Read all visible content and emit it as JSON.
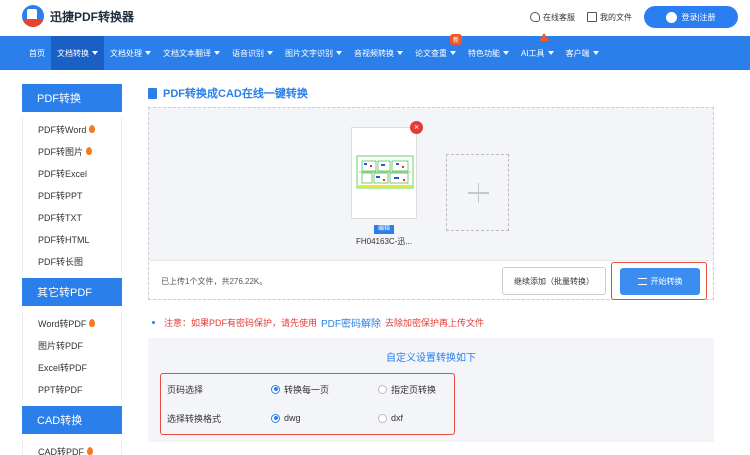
{
  "header": {
    "logo_text": "迅捷PDF转换器",
    "service_label": "在线客服",
    "files_label": "我的文件",
    "login_label": "登录|注册"
  },
  "nav": {
    "items": [
      {
        "label": "首页"
      },
      {
        "label": "文档转换"
      },
      {
        "label": "文档处理"
      },
      {
        "label": "文档文本翻译"
      },
      {
        "label": "语音识别"
      },
      {
        "label": "图片文字识别"
      },
      {
        "label": "音视频转换"
      },
      {
        "label": "论文查重",
        "badge": "新"
      },
      {
        "label": "特色功能"
      },
      {
        "label": "AI工具"
      },
      {
        "label": "客户端"
      }
    ]
  },
  "sidebar": {
    "group1": {
      "title": "PDF转换",
      "items": [
        "PDF转Word",
        "PDF转图片",
        "PDF转Excel",
        "PDF转PPT",
        "PDF转TXT",
        "PDF转HTML",
        "PDF转长图"
      ]
    },
    "group2": {
      "title": "其它转PDF",
      "items": [
        "Word转PDF",
        "图片转PDF",
        "Excel转PDF",
        "PPT转PDF"
      ]
    },
    "group3": {
      "title": "CAD转换",
      "items": [
        "CAD转PDF"
      ]
    }
  },
  "main": {
    "title": "PDF转换成CAD在线一键转换",
    "file": {
      "name": "FH04163C-迅...",
      "edit_label": "编辑",
      "delete_symbol": "×"
    },
    "upload_info": "已上传1个文件，共276.22K。",
    "batch_label": "继续添加（批量转换）",
    "start_label": "开始转换",
    "note": {
      "prefix": "注意：如果PDF有密码保护，请先使用",
      "link": "PDF密码解除",
      "suffix": "去除加密保护再上传文件"
    },
    "settings": {
      "title": "自定义设置转换如下",
      "page_label": "页码选择",
      "page_opt1": "转换每一页",
      "page_opt2": "指定页转换",
      "format_label": "选择转换格式",
      "format_opt1": "dwg",
      "format_opt2": "dxf"
    }
  },
  "colors": {
    "primary": "#2b7fea",
    "alert": "#e53935",
    "highlight_box": "#e74c3c"
  }
}
